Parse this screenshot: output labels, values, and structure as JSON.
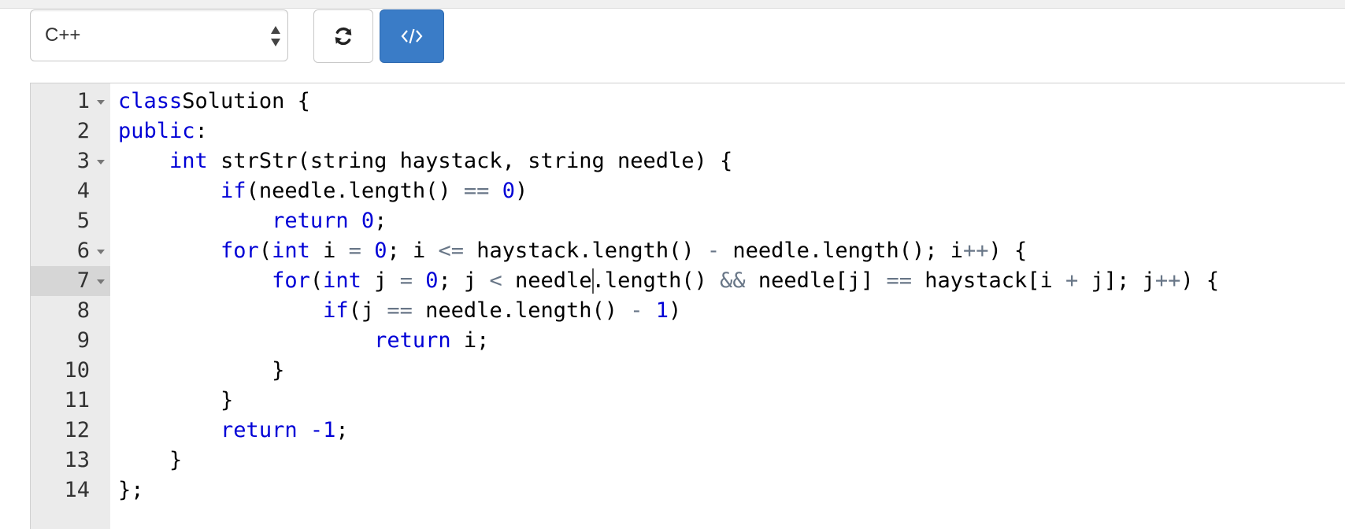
{
  "toolbar": {
    "language": "C++",
    "reset_icon": "refresh-icon",
    "code_icon": "code-brackets-icon",
    "accent_color": "#3a7cc7"
  },
  "editor": {
    "active_line": 7,
    "lines": [
      {
        "n": "1",
        "fold": true,
        "tokens": [
          [
            "kw",
            "class"
          ],
          [
            "",
            "Solution {"
          ]
        ]
      },
      {
        "n": "2",
        "fold": false,
        "tokens": [
          [
            "kw",
            "public"
          ],
          [
            "",
            ":"
          ]
        ]
      },
      {
        "n": "3",
        "fold": true,
        "tokens": [
          [
            "",
            "    "
          ],
          [
            "kw",
            "int"
          ],
          [
            "",
            " strStr(string haystack, string needle) {"
          ]
        ]
      },
      {
        "n": "4",
        "fold": false,
        "tokens": [
          [
            "",
            "        "
          ],
          [
            "kw",
            "if"
          ],
          [
            "",
            "(needle.length() "
          ],
          [
            "op",
            "=="
          ],
          [
            "",
            " "
          ],
          [
            "num-lit",
            "0"
          ],
          [
            "",
            ")"
          ]
        ]
      },
      {
        "n": "5",
        "fold": false,
        "tokens": [
          [
            "",
            "            "
          ],
          [
            "kw",
            "return"
          ],
          [
            "",
            " "
          ],
          [
            "num-lit",
            "0"
          ],
          [
            "",
            ";"
          ]
        ]
      },
      {
        "n": "6",
        "fold": true,
        "tokens": [
          [
            "",
            "        "
          ],
          [
            "kw",
            "for"
          ],
          [
            "",
            "("
          ],
          [
            "kw",
            "int"
          ],
          [
            "",
            " i "
          ],
          [
            "op",
            "="
          ],
          [
            "",
            " "
          ],
          [
            "num-lit",
            "0"
          ],
          [
            "",
            "; i "
          ],
          [
            "op",
            "<="
          ],
          [
            "",
            " haystack.length() "
          ],
          [
            "op",
            "-"
          ],
          [
            "",
            " needle.length(); i"
          ],
          [
            "op",
            "++"
          ],
          [
            "",
            ") {"
          ]
        ]
      },
      {
        "n": "7",
        "fold": true,
        "tokens": [
          [
            "",
            "            "
          ],
          [
            "kw",
            "for"
          ],
          [
            "",
            "("
          ],
          [
            "kw",
            "int"
          ],
          [
            "",
            " j "
          ],
          [
            "op",
            "="
          ],
          [
            "",
            " "
          ],
          [
            "num-lit",
            "0"
          ],
          [
            "",
            "; j "
          ],
          [
            "op",
            "<"
          ],
          [
            "",
            " needle.length() "
          ],
          [
            "op",
            "&&"
          ],
          [
            "",
            " needle[j] "
          ],
          [
            "op",
            "=="
          ],
          [
            "",
            " haystack[i "
          ],
          [
            "op",
            "+"
          ],
          [
            "",
            " j]; j"
          ],
          [
            "op",
            "++"
          ],
          [
            "",
            ") {"
          ]
        ]
      },
      {
        "n": "8",
        "fold": false,
        "tokens": [
          [
            "",
            "                "
          ],
          [
            "kw",
            "if"
          ],
          [
            "",
            "(j "
          ],
          [
            "op",
            "=="
          ],
          [
            "",
            " needle.length() "
          ],
          [
            "op",
            "-"
          ],
          [
            "",
            " "
          ],
          [
            "num-lit",
            "1"
          ],
          [
            "",
            ")"
          ]
        ]
      },
      {
        "n": "9",
        "fold": false,
        "tokens": [
          [
            "",
            "                    "
          ],
          [
            "kw",
            "return"
          ],
          [
            "",
            " i;"
          ]
        ]
      },
      {
        "n": "10",
        "fold": false,
        "tokens": [
          [
            "",
            "            }"
          ]
        ]
      },
      {
        "n": "11",
        "fold": false,
        "tokens": [
          [
            "",
            "        }"
          ]
        ]
      },
      {
        "n": "12",
        "fold": false,
        "tokens": [
          [
            "",
            "        "
          ],
          [
            "kw",
            "return"
          ],
          [
            "",
            " "
          ],
          [
            "num-lit",
            "-1"
          ],
          [
            "",
            ";"
          ]
        ]
      },
      {
        "n": "13",
        "fold": false,
        "tokens": [
          [
            "",
            "    }"
          ]
        ]
      },
      {
        "n": "14",
        "fold": false,
        "tokens": [
          [
            "",
            "};"
          ]
        ]
      }
    ]
  }
}
